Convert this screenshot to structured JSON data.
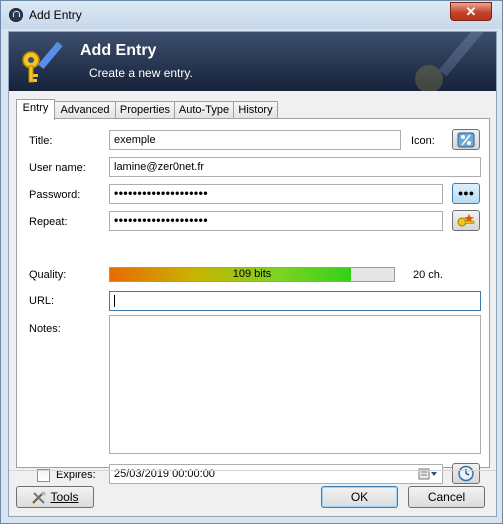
{
  "window": {
    "title": "Add Entry",
    "close_glyph": "✕"
  },
  "banner": {
    "title": "Add Entry",
    "subtitle": "Create a new entry."
  },
  "tabs": [
    {
      "label": "Entry",
      "active": true
    },
    {
      "label": "Advanced",
      "active": false
    },
    {
      "label": "Properties",
      "active": false
    },
    {
      "label": "Auto-Type",
      "active": false
    },
    {
      "label": "History",
      "active": false
    }
  ],
  "fields": {
    "title_label": "Title:",
    "title_value": "exemple",
    "icon_label": "Icon:",
    "username_label": "User name:",
    "username_value": "lamine@zer0net.fr",
    "password_label": "Password:",
    "password_value": "••••••••••••••••••••",
    "repeat_label": "Repeat:",
    "repeat_value": "••••••••••••••••••••",
    "quality_label": "Quality:",
    "quality_text": "109 bits",
    "quality_fraction": 0.85,
    "char_count": "20 ch.",
    "url_label": "URL:",
    "url_value": "",
    "notes_label": "Notes:",
    "expires_label": "Expires:",
    "expires_checked": false,
    "expires_value": "25/03/2019 00:00:00"
  },
  "buttons": {
    "tools": "Tools",
    "ok": "OK",
    "cancel": "Cancel",
    "show_password": "●●●"
  },
  "colors": {
    "banner_top": "#3d4f6d",
    "banner_bottom": "#15223a",
    "accent": "#3c7fb1"
  },
  "icons": [
    "lock-icon",
    "key-pen-icon",
    "percent-icon",
    "dots-icon",
    "key-generator-icon",
    "calendar-icon",
    "clock-icon",
    "tools-icon"
  ]
}
